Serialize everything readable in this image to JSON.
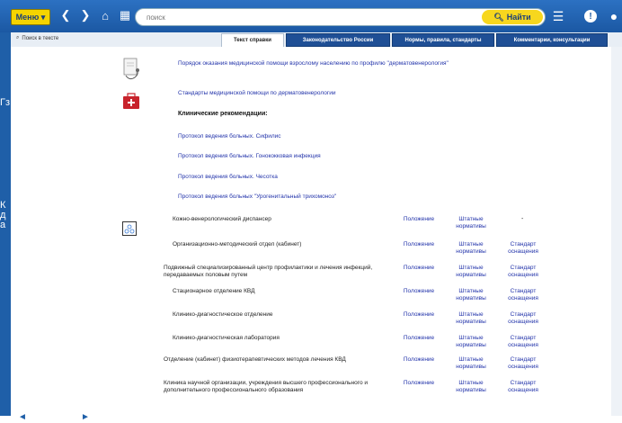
{
  "topbar": {
    "menu_label": "Меню ▾",
    "search_value": "",
    "search_placeholder": "поиск",
    "find_label": "Найти"
  },
  "left_strip": {
    "labels": [
      "Гз",
      "К",
      "д",
      "а"
    ]
  },
  "tabbar": {
    "text_search_label": "Поиск в тексте",
    "tabs": [
      {
        "label": "Текст справки"
      },
      {
        "label": "Законодательство России"
      },
      {
        "label": "Нормы, правила, стандарты"
      },
      {
        "label": "Комментарии, консультации"
      }
    ]
  },
  "content": {
    "link_order": "Порядок оказания медицинской помощи взрослому населению по профилю \"дерматовенерология\"",
    "link_standards": "Стандарты медицинской помощи по дерматовенерологии",
    "clinical_heading": "Клинические рекомендации:",
    "protocols": [
      "Протокол ведения больных. Сифилис",
      "Протокол ведения больных. Гонококковая инфекция",
      "Протокол ведения больных. Чесотка",
      "Протокол ведения больных \"Урогенитальный трихомоноз\""
    ],
    "rows": [
      {
        "name": "Кожно-венерологический диспансер",
        "reg": "Положение",
        "staff": "Штатные нормативы",
        "std": "-"
      },
      {
        "name": "Организационно-методический отдел (кабинет)",
        "reg": "Положение",
        "staff": "Штатные нормативы",
        "std": "Стандарт оснащения"
      },
      {
        "name": "Подвижный специализированный центр профилактики и лечения инфекций, передаваемых половым путем",
        "reg": "Положение",
        "staff": "Штатные нормативы",
        "std": "Стандарт оснащения"
      },
      {
        "name": "Стационарное отделение КВД",
        "reg": "Положение",
        "staff": "Штатные нормативы",
        "std": "Стандарт оснащения"
      },
      {
        "name": "Клинико-диагностическое отделение",
        "reg": "Положение",
        "staff": "Штатные нормативы",
        "std": "Стандарт оснащения"
      },
      {
        "name": "Клинико-диагностическая лаборатория",
        "reg": "Положение",
        "staff": "Штатные нормативы",
        "std": "Стандарт оснащения"
      },
      {
        "name": "Отделение (кабинет) физиотерапевтических методов лечения КВД",
        "reg": "Положение",
        "staff": "Штатные нормативы",
        "std": "Стандарт оснащения"
      },
      {
        "name": "Клиника научной организации, учреждения высшего профессионального и дополнительного профессионального образования",
        "reg": "Положение",
        "staff": "Штатные нормативы",
        "std": "Стандарт оснащения"
      }
    ]
  }
}
